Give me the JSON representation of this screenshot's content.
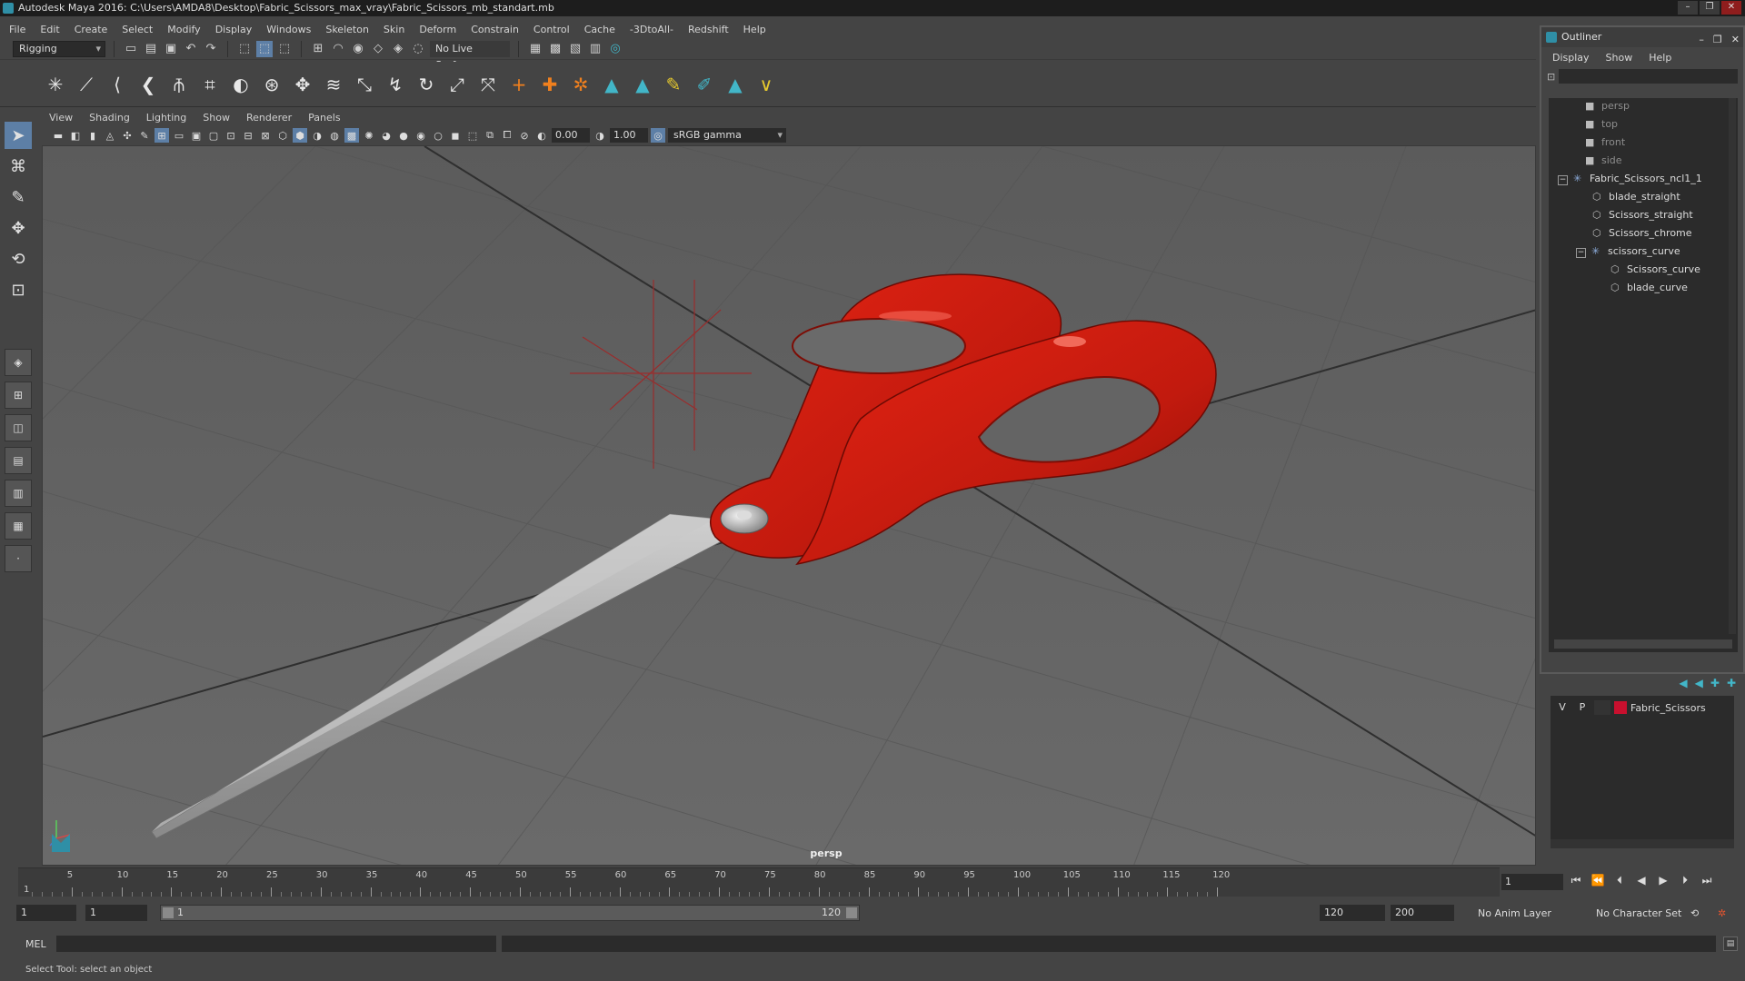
{
  "window": {
    "title": "Autodesk Maya 2016: C:\\Users\\AMDA8\\Desktop\\Fabric_Scissors_max_vray\\Fabric_Scissors_mb_standart.mb",
    "controls": [
      "–",
      "❐",
      "✕"
    ]
  },
  "menubar": [
    "File",
    "Edit",
    "Create",
    "Select",
    "Modify",
    "Display",
    "Windows",
    "Skeleton",
    "Skin",
    "Deform",
    "Constrain",
    "Control",
    "Cache",
    "-3DtoAll-",
    "Redshift",
    "Help"
  ],
  "statusline": {
    "menuset": "Rigging",
    "live_surface": "No Live Surface"
  },
  "panel": {
    "menus": [
      "View",
      "Shading",
      "Lighting",
      "Show",
      "Renderer",
      "Panels"
    ],
    "exposure": "0.00",
    "gamma_value": "1.00",
    "color_space": "sRGB gamma",
    "camera": "persp"
  },
  "colors": {
    "accent": "#5d7fa6",
    "maya_teal": "#2f8fa6",
    "layer_color": "#c8102e",
    "handle_red": "#c41a10",
    "blade_gray": "#b8b8b8"
  },
  "timeline": {
    "ticks": [
      "5",
      "10",
      "15",
      "20",
      "25",
      "30",
      "35",
      "40",
      "45",
      "50",
      "55",
      "60",
      "65",
      "70",
      "75",
      "80",
      "85",
      "90",
      "95",
      "100",
      "105",
      "110",
      "115",
      "120"
    ],
    "start_marker": "1",
    "current_frame": "1"
  },
  "range": {
    "start_time": "1",
    "playback_start": "1",
    "slider_start": "1",
    "slider_end": "120",
    "playback_end": "120",
    "end_time": "200",
    "anim_layer": "No Anim Layer",
    "character_set": "No Character Set"
  },
  "cmdline": {
    "label": "MEL"
  },
  "helpline": "Select Tool: select an object",
  "outliner": {
    "title": "Outliner",
    "menus": [
      "Display",
      "Show",
      "Help"
    ],
    "cameras": [
      "persp",
      "top",
      "front",
      "side"
    ],
    "root": "Fabric_Scissors_ncl1_1",
    "children": [
      "blade_straight",
      "Scissors_straight",
      "Scissors_chrome"
    ],
    "group": "scissors_curve",
    "group_children": [
      "Scissors_curve",
      "blade_curve"
    ]
  },
  "layers": {
    "v": "V",
    "p": "P",
    "name": "Fabric_Scissors"
  }
}
